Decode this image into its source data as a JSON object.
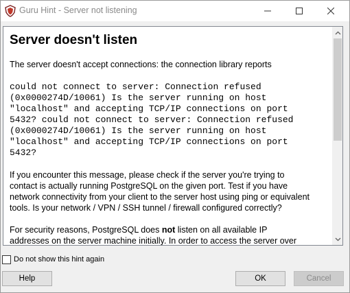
{
  "window": {
    "title": "Guru Hint - Server not listening"
  },
  "icons": {
    "app": "guru-hint-shield-icon",
    "minimize": "minimize-icon",
    "maximize": "maximize-icon",
    "close": "close-icon",
    "scroll_up": "chevron-up-icon",
    "scroll_down": "chevron-down-icon"
  },
  "hint": {
    "heading": "Server doesn't listen",
    "intro": "The server doesn't accept connections: the connection library reports",
    "error_lines": [
      "could not connect to server: Connection refused",
      "(0x0000274D/10061) Is the server running on host",
      "\"localhost\" and accepting TCP/IP connections on port",
      "5432? could not connect to server: Connection refused",
      "(0x0000274D/10061) Is the server running on host",
      "\"localhost\" and accepting TCP/IP connections on port",
      "5432?"
    ],
    "para1_lines": [
      "If you encounter this message, please check if the server you're trying to",
      "contact is actually running PostgreSQL on the given port. Test if you have",
      "network connectivity from your client to the server host using ping or equivalent",
      "tools. Is your network / VPN / SSH tunnel / firewall configured correctly?"
    ],
    "para2_line1_pre": "For security reasons, PostgreSQL does ",
    "para2_line1_bold": "not",
    "para2_line1_post": " listen on all available IP",
    "para2_line2": "addresses on the server machine initially. In order to access the server over"
  },
  "footer": {
    "checkbox_label": "Do not show this hint again",
    "checkbox_checked": false,
    "help_label": "Help",
    "ok_label": "OK",
    "cancel_label": "Cancel"
  },
  "colors": {
    "app_icon_red": "#c0392b",
    "disabled_text": "#8a8a8a"
  }
}
